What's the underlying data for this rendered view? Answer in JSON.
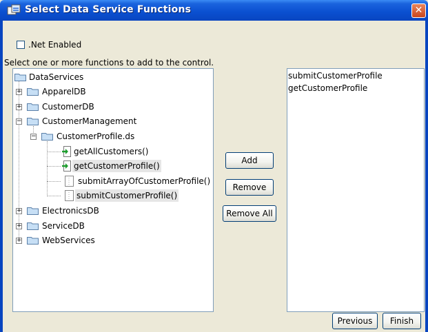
{
  "window": {
    "title": "Select Data Service Functions",
    "close_glyph": "✕"
  },
  "options": {
    "net_enabled_label": ".Net Enabled",
    "net_enabled_checked": false
  },
  "instruction": "Select one or more functions to add to the control.",
  "tree": {
    "root": "DataServices",
    "items": [
      {
        "label": "ApparelDB",
        "type": "folder",
        "expanded": false
      },
      {
        "label": "CustomerDB",
        "type": "folder",
        "expanded": false
      },
      {
        "label": "CustomerManagement",
        "type": "folder",
        "expanded": true
      },
      {
        "label": "CustomerProfile.ds",
        "type": "folder",
        "expanded": true
      },
      {
        "label": "getAllCustomers()",
        "type": "function-arrow-icon"
      },
      {
        "label": "getCustomerProfile()",
        "type": "function-arrow-icon",
        "selected": true
      },
      {
        "label": "submitArrayOfCustomerProfile()",
        "type": "document-icon"
      },
      {
        "label": "submitCustomerProfile()",
        "type": "document-icon",
        "selected": true
      },
      {
        "label": "ElectronicsDB",
        "type": "folder",
        "expanded": false
      },
      {
        "label": "ServiceDB",
        "type": "folder",
        "expanded": false
      },
      {
        "label": "WebServices",
        "type": "folder",
        "expanded": false
      }
    ]
  },
  "buttons": {
    "add": "Add",
    "remove": "Remove",
    "remove_all": "Remove All",
    "previous": "Previous",
    "finish": "Finish"
  },
  "selected_functions": [
    "submitCustomerProfile",
    "getCustomerProfile"
  ],
  "colors": {
    "titlebar": "#0a4fd0",
    "dialog_bg": "#ece9d8",
    "folder": "#c7dff5",
    "arrow": "#1c9d2c"
  }
}
